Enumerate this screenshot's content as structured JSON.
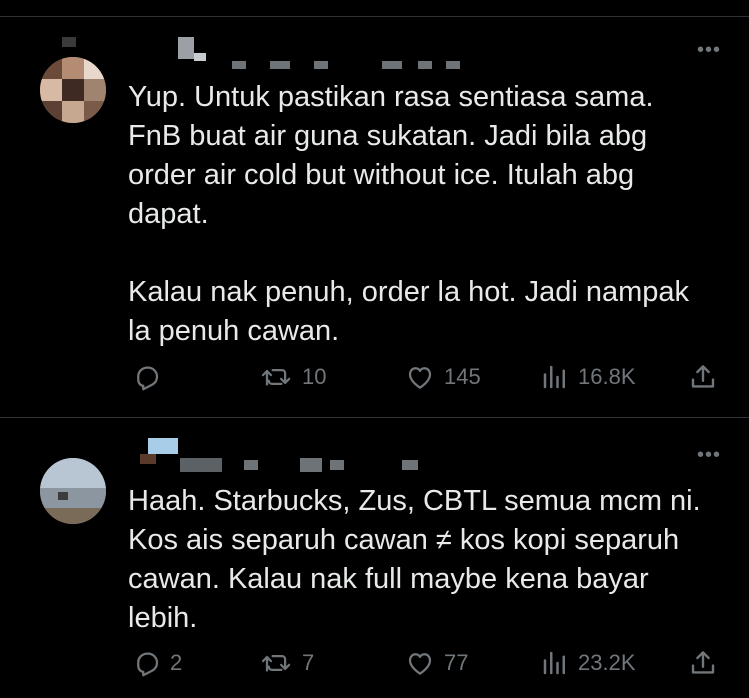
{
  "colors": {
    "background": "#000000",
    "text_primary": "#e7e9ea",
    "text_secondary": "#71767b",
    "divider": "#2f3336"
  },
  "tweets": [
    {
      "more_label": "•••",
      "body": "Yup. Untuk pastikan rasa sentiasa sama.\nFnB buat air guna sukatan. Jadi bila abg\norder air cold but without ice. Itulah abg\ndapat.\n\nKalau nak penuh, order la hot. Jadi nampak\nla penuh cawan.",
      "actions": {
        "reply_count": "",
        "retweet_count": "10",
        "like_count": "145",
        "view_count": "16.8K"
      }
    },
    {
      "more_label": "•••",
      "body": "Haah. Starbucks, Zus, CBTL semua mcm ni.\nKos ais separuh cawan ≠ kos kopi separuh\ncawan. Kalau nak full maybe kena bayar\nlebih.",
      "actions": {
        "reply_count": "2",
        "retweet_count": "7",
        "like_count": "77",
        "view_count": "23.2K"
      }
    }
  ],
  "icons": [
    "reply-icon",
    "retweet-icon",
    "like-icon",
    "views-icon",
    "share-icon",
    "more-icon"
  ]
}
